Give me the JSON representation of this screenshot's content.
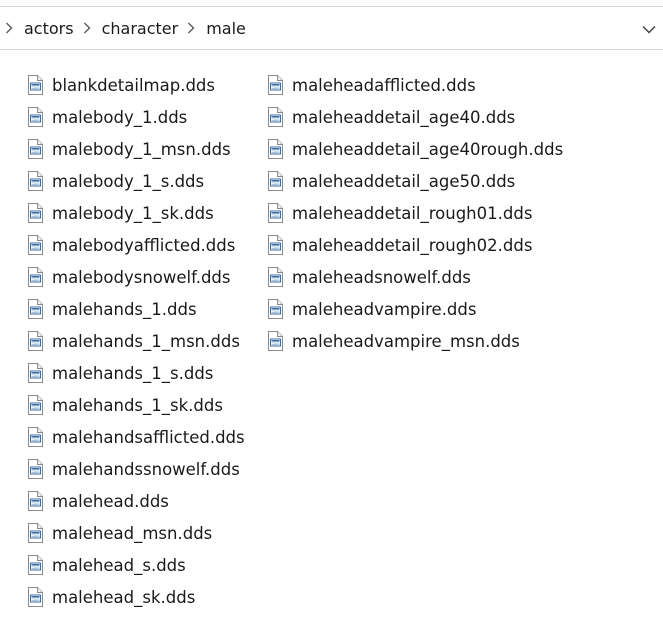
{
  "breadcrumb": {
    "items": [
      "actors",
      "character",
      "male"
    ]
  },
  "icons": {
    "separator": "chevron-right-icon",
    "dropdown": "chevron-down-icon",
    "file": "dds-file-icon"
  },
  "files": {
    "column1": [
      "blankdetailmap.dds",
      "malebody_1.dds",
      "malebody_1_msn.dds",
      "malebody_1_s.dds",
      "malebody_1_sk.dds",
      "malebodyafflicted.dds",
      "malebodysnowelf.dds",
      "malehands_1.dds",
      "malehands_1_msn.dds",
      "malehands_1_s.dds",
      "malehands_1_sk.dds",
      "malehandsafflicted.dds",
      "malehandssnowelf.dds",
      "malehead.dds",
      "malehead_msn.dds",
      "malehead_s.dds",
      "malehead_sk.dds"
    ],
    "column2": [
      "maleheadafflicted.dds",
      "maleheaddetail_age40.dds",
      "maleheaddetail_age40rough.dds",
      "maleheaddetail_age50.dds",
      "maleheaddetail_rough01.dds",
      "maleheaddetail_rough02.dds",
      "maleheadsnowelf.dds",
      "maleheadvampire.dds",
      "maleheadvampire_msn.dds"
    ]
  }
}
